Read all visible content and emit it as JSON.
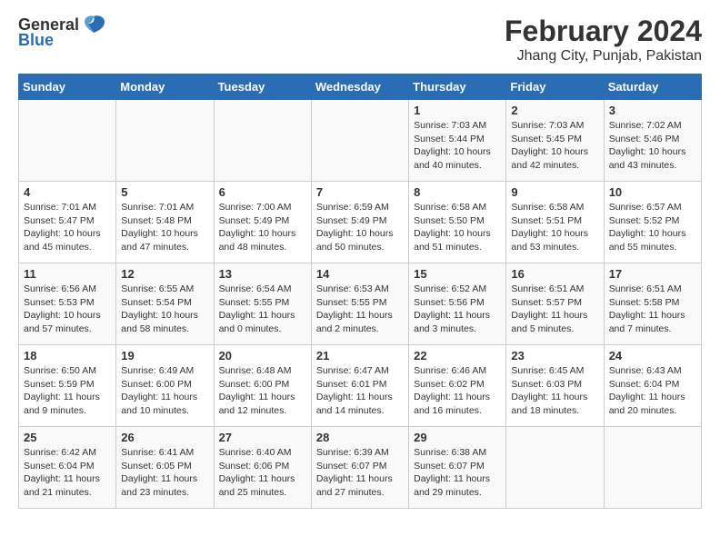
{
  "header": {
    "logo_general": "General",
    "logo_blue": "Blue",
    "month": "February 2024",
    "location": "Jhang City, Punjab, Pakistan"
  },
  "weekdays": [
    "Sunday",
    "Monday",
    "Tuesday",
    "Wednesday",
    "Thursday",
    "Friday",
    "Saturday"
  ],
  "weeks": [
    [
      {
        "day": "",
        "info": ""
      },
      {
        "day": "",
        "info": ""
      },
      {
        "day": "",
        "info": ""
      },
      {
        "day": "",
        "info": ""
      },
      {
        "day": "1",
        "info": "Sunrise: 7:03 AM\nSunset: 5:44 PM\nDaylight: 10 hours\nand 40 minutes."
      },
      {
        "day": "2",
        "info": "Sunrise: 7:03 AM\nSunset: 5:45 PM\nDaylight: 10 hours\nand 42 minutes."
      },
      {
        "day": "3",
        "info": "Sunrise: 7:02 AM\nSunset: 5:46 PM\nDaylight: 10 hours\nand 43 minutes."
      }
    ],
    [
      {
        "day": "4",
        "info": "Sunrise: 7:01 AM\nSunset: 5:47 PM\nDaylight: 10 hours\nand 45 minutes."
      },
      {
        "day": "5",
        "info": "Sunrise: 7:01 AM\nSunset: 5:48 PM\nDaylight: 10 hours\nand 47 minutes."
      },
      {
        "day": "6",
        "info": "Sunrise: 7:00 AM\nSunset: 5:49 PM\nDaylight: 10 hours\nand 48 minutes."
      },
      {
        "day": "7",
        "info": "Sunrise: 6:59 AM\nSunset: 5:49 PM\nDaylight: 10 hours\nand 50 minutes."
      },
      {
        "day": "8",
        "info": "Sunrise: 6:58 AM\nSunset: 5:50 PM\nDaylight: 10 hours\nand 51 minutes."
      },
      {
        "day": "9",
        "info": "Sunrise: 6:58 AM\nSunset: 5:51 PM\nDaylight: 10 hours\nand 53 minutes."
      },
      {
        "day": "10",
        "info": "Sunrise: 6:57 AM\nSunset: 5:52 PM\nDaylight: 10 hours\nand 55 minutes."
      }
    ],
    [
      {
        "day": "11",
        "info": "Sunrise: 6:56 AM\nSunset: 5:53 PM\nDaylight: 10 hours\nand 57 minutes."
      },
      {
        "day": "12",
        "info": "Sunrise: 6:55 AM\nSunset: 5:54 PM\nDaylight: 10 hours\nand 58 minutes."
      },
      {
        "day": "13",
        "info": "Sunrise: 6:54 AM\nSunset: 5:55 PM\nDaylight: 11 hours\nand 0 minutes."
      },
      {
        "day": "14",
        "info": "Sunrise: 6:53 AM\nSunset: 5:55 PM\nDaylight: 11 hours\nand 2 minutes."
      },
      {
        "day": "15",
        "info": "Sunrise: 6:52 AM\nSunset: 5:56 PM\nDaylight: 11 hours\nand 3 minutes."
      },
      {
        "day": "16",
        "info": "Sunrise: 6:51 AM\nSunset: 5:57 PM\nDaylight: 11 hours\nand 5 minutes."
      },
      {
        "day": "17",
        "info": "Sunrise: 6:51 AM\nSunset: 5:58 PM\nDaylight: 11 hours\nand 7 minutes."
      }
    ],
    [
      {
        "day": "18",
        "info": "Sunrise: 6:50 AM\nSunset: 5:59 PM\nDaylight: 11 hours\nand 9 minutes."
      },
      {
        "day": "19",
        "info": "Sunrise: 6:49 AM\nSunset: 6:00 PM\nDaylight: 11 hours\nand 10 minutes."
      },
      {
        "day": "20",
        "info": "Sunrise: 6:48 AM\nSunset: 6:00 PM\nDaylight: 11 hours\nand 12 minutes."
      },
      {
        "day": "21",
        "info": "Sunrise: 6:47 AM\nSunset: 6:01 PM\nDaylight: 11 hours\nand 14 minutes."
      },
      {
        "day": "22",
        "info": "Sunrise: 6:46 AM\nSunset: 6:02 PM\nDaylight: 11 hours\nand 16 minutes."
      },
      {
        "day": "23",
        "info": "Sunrise: 6:45 AM\nSunset: 6:03 PM\nDaylight: 11 hours\nand 18 minutes."
      },
      {
        "day": "24",
        "info": "Sunrise: 6:43 AM\nSunset: 6:04 PM\nDaylight: 11 hours\nand 20 minutes."
      }
    ],
    [
      {
        "day": "25",
        "info": "Sunrise: 6:42 AM\nSunset: 6:04 PM\nDaylight: 11 hours\nand 21 minutes."
      },
      {
        "day": "26",
        "info": "Sunrise: 6:41 AM\nSunset: 6:05 PM\nDaylight: 11 hours\nand 23 minutes."
      },
      {
        "day": "27",
        "info": "Sunrise: 6:40 AM\nSunset: 6:06 PM\nDaylight: 11 hours\nand 25 minutes."
      },
      {
        "day": "28",
        "info": "Sunrise: 6:39 AM\nSunset: 6:07 PM\nDaylight: 11 hours\nand 27 minutes."
      },
      {
        "day": "29",
        "info": "Sunrise: 6:38 AM\nSunset: 6:07 PM\nDaylight: 11 hours\nand 29 minutes."
      },
      {
        "day": "",
        "info": ""
      },
      {
        "day": "",
        "info": ""
      }
    ]
  ]
}
